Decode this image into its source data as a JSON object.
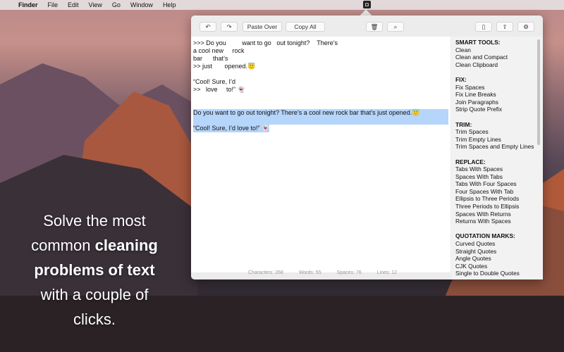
{
  "menubar": {
    "apple": "",
    "app": "Finder",
    "items": [
      "File",
      "Edit",
      "View",
      "Go",
      "Window",
      "Help"
    ]
  },
  "toolbar": {
    "undo": "↶",
    "redo": "↷",
    "paste_over": "Paste Over",
    "copy_all": "Copy All",
    "trash": "🗑",
    "search": "⌕",
    "doc": "▯",
    "share": "⇧",
    "gear": "⚙"
  },
  "editor": {
    "raw_lines": [
      ">>> Do you         want to go   out tonight?    There’s",
      "a cool new     rock",
      "bar      that’s",
      ">> just       opened.😇",
      "",
      "“Cool! Sure, I’d",
      ">>   love     to!” 👻",
      "",
      ""
    ],
    "selected_lines": [
      "Do you want to go out tonight? There’s a cool new rock bar that’s just opened.😇",
      "",
      "“Cool! Sure, I’d love to!” 👻"
    ]
  },
  "status": {
    "characters": "Characters: 268",
    "words": "Words: 55",
    "spaces": "Spaces: 76",
    "lines": "Lines: 12"
  },
  "sidebar": [
    {
      "heading": "SMART TOOLS:",
      "items": [
        "Clean",
        "Clean and Compact",
        "Clean Clipboard"
      ]
    },
    {
      "heading": "FIX:",
      "items": [
        "Fix Spaces",
        "Fix Line Breaks",
        "Join Paragraphs",
        "Strip Quote Prefix"
      ]
    },
    {
      "heading": "TRIM:",
      "items": [
        "Trim Spaces",
        "Trim Empty Lines",
        "Trim Spaces and Empty Lines"
      ]
    },
    {
      "heading": "REPLACE:",
      "items": [
        "Tabs With Spaces",
        "Spaces With Tabs",
        "Tabs With Four Spaces",
        "Four Spaces With Tab",
        "Ellipsis to Three Periods",
        "Three Periods to Ellipsis",
        "Spaces With Returns",
        "Returns With Spaces"
      ]
    },
    {
      "heading": "QUOTATION MARKS:",
      "items": [
        "Curved Quotes",
        "Straight Quotes",
        "Angle Quotes",
        "CJK Quotes",
        "Single to Double Quotes"
      ]
    }
  ],
  "promo": {
    "l1": "Solve the most",
    "l2a": "common ",
    "l2b": "cleaning",
    "l3": "problems of text",
    "l4": "with a couple of",
    "l5": "clicks."
  }
}
